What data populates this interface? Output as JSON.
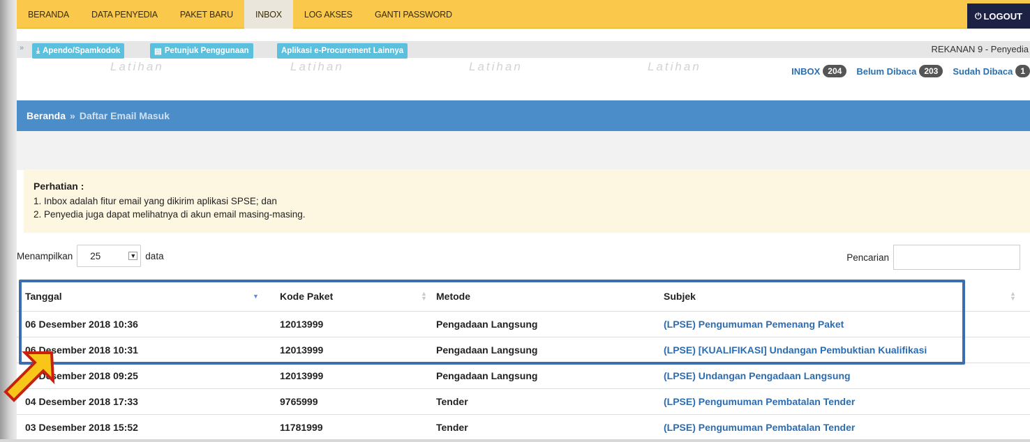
{
  "nav": {
    "items": [
      "BERANDA",
      "DATA PENYEDIA",
      "PAKET BARU",
      "INBOX",
      "LOG AKSES",
      "GANTI PASSWORD"
    ],
    "active": "INBOX",
    "logout": "LOGOUT"
  },
  "toolbar": {
    "btn_apendo": "Apendo/Spamkodok",
    "btn_petunjuk": "Petunjuk Penggunaan",
    "btn_aplikasi": "Aplikasi e-Procurement Lainnya",
    "user": "REKANAN 9 - Penyedia"
  },
  "watermark": "Latihan",
  "counters": {
    "inbox_label": "INBOX",
    "inbox_count": "204",
    "unread_label": "Belum Dibaca",
    "unread_count": "203",
    "read_label": "Sudah Dibaca",
    "read_count": "1"
  },
  "breadcrumb": {
    "home": "Beranda",
    "separator": "»",
    "current": "Daftar Email Masuk"
  },
  "notice": {
    "title": "Perhatian :",
    "line1": "1. Inbox adalah fitur email yang dikirim aplikasi SPSE; dan",
    "line2": "2. Penyedia juga dapat melihatnya di akun email masing-masing."
  },
  "length": {
    "prefix": "Menampilkan",
    "value": "25",
    "suffix": "data"
  },
  "search": {
    "label": "Pencarian",
    "value": ""
  },
  "table": {
    "headers": {
      "tanggal": "Tanggal",
      "kode": "Kode Paket",
      "metode": "Metode",
      "subjek": "Subjek"
    },
    "rows": [
      {
        "tanggal": "06 Desember 2018 10:36",
        "kode": "12013999",
        "metode": "Pengadaan Langsung",
        "subjek": "(LPSE) Pengumuman Pemenang Paket"
      },
      {
        "tanggal": "06 Desember 2018 10:31",
        "kode": "12013999",
        "metode": "Pengadaan Langsung",
        "subjek": "(LPSE) [KUALIFIKASI] Undangan Pembuktian Kualifikasi"
      },
      {
        "tanggal": "06 Desember 2018 09:25",
        "kode": "12013999",
        "metode": "Pengadaan Langsung",
        "subjek": "(LPSE) Undangan Pengadaan Langsung"
      },
      {
        "tanggal": "04 Desember 2018 17:33",
        "kode": "9765999",
        "metode": "Tender",
        "subjek": "(LPSE) Pengumuman Pembatalan Tender"
      },
      {
        "tanggal": "03 Desember 2018 15:52",
        "kode": "11781999",
        "metode": "Tender",
        "subjek": "(LPSE) Pengumuman Pembatalan Tender"
      }
    ]
  },
  "colors": {
    "nav_bg": "#fac94c",
    "logout_bg": "#1d2245",
    "crumb_bg": "#4b8dc9",
    "link": "#2c6cb0",
    "highlight": "#3a6eb0",
    "arrow_fill": "#f7c619",
    "arrow_stroke": "#c8200e"
  }
}
